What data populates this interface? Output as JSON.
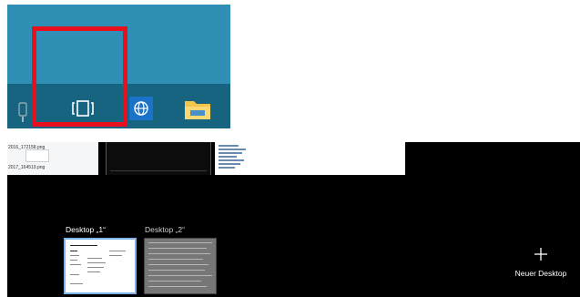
{
  "taskbar": {
    "icons": [
      "phone-icon",
      "task-view-icon",
      "globe-icon",
      "file-explorer-icon"
    ],
    "highlight_color": "#e8101c",
    "background_color": "#176481"
  },
  "task_view": {
    "window_thumbnails": {
      "file_names": [
        "2016_172158.png",
        "2017_164519.png"
      ]
    },
    "desktops": [
      {
        "label": "Desktop „1“",
        "selected": true
      },
      {
        "label": "Desktop „2“",
        "selected": false
      }
    ],
    "new_desktop": {
      "label": "Neuer Desktop",
      "icon": "plus-icon"
    },
    "accent_color": "#7fb2e6"
  }
}
